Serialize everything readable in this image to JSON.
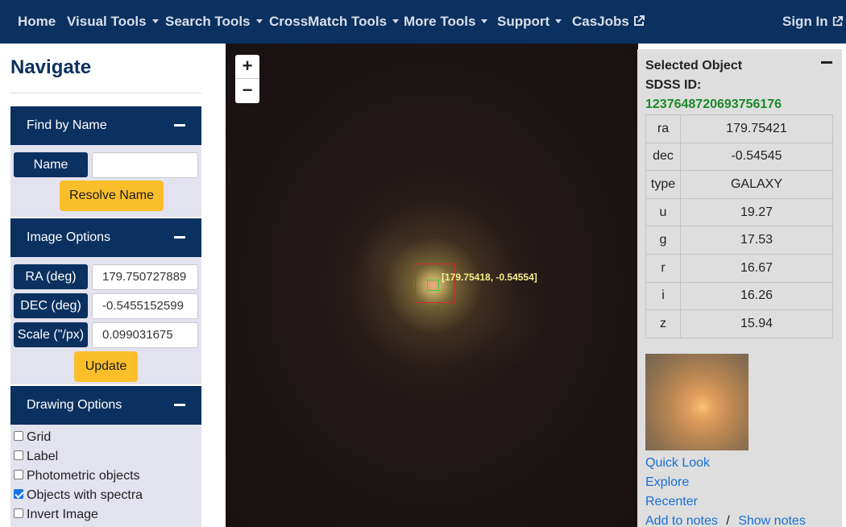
{
  "navbar": {
    "items": [
      {
        "label": "Home",
        "dropdown": false
      },
      {
        "label": "Visual Tools",
        "dropdown": true
      },
      {
        "label": "Search Tools",
        "dropdown": true
      },
      {
        "label": "CrossMatch Tools",
        "dropdown": true
      },
      {
        "label": "More Tools",
        "dropdown": true
      },
      {
        "label": "Support",
        "dropdown": true
      },
      {
        "label": "CasJobs",
        "external": true
      }
    ],
    "sign_in": "Sign In"
  },
  "sidebar": {
    "title": "Navigate",
    "find_by_name": {
      "header": "Find by Name",
      "name_label": "Name",
      "name_value": "",
      "resolve_button": "Resolve Name"
    },
    "image_options": {
      "header": "Image Options",
      "ra_label": "RA (deg)",
      "ra_value": "179.750727889",
      "dec_label": "DEC (deg)",
      "dec_value": "-0.5455152599",
      "scale_label": "Scale (\"/px)",
      "scale_value": "0.099031675",
      "update_button": "Update"
    },
    "drawing_options": {
      "header": "Drawing Options",
      "checkboxes": [
        {
          "label": "Grid",
          "checked": false
        },
        {
          "label": "Label",
          "checked": false
        },
        {
          "label": "Photometric objects",
          "checked": false
        },
        {
          "label": "Objects with spectra",
          "checked": true
        },
        {
          "label": "Invert Image",
          "checked": false
        }
      ]
    }
  },
  "map": {
    "zoom_in": "+",
    "zoom_out": "−",
    "marker_label": "[179.75418, -0.54554]"
  },
  "selected_object": {
    "title": "Selected Object",
    "sdss_label": "SDSS ID:",
    "sdss_id": "1237648720693756176",
    "rows": [
      {
        "key": "ra",
        "value": "179.75421"
      },
      {
        "key": "dec",
        "value": "-0.54545"
      },
      {
        "key": "type",
        "value": "GALAXY"
      },
      {
        "key": "u",
        "value": "19.27"
      },
      {
        "key": "g",
        "value": "17.53"
      },
      {
        "key": "r",
        "value": "16.67"
      },
      {
        "key": "i",
        "value": "16.26"
      },
      {
        "key": "z",
        "value": "15.94"
      }
    ],
    "links": {
      "quick_look": "Quick Look",
      "explore": "Explore",
      "recenter": "Recenter",
      "add_notes": "Add to notes",
      "separator": "/",
      "show_notes": "Show notes"
    }
  },
  "colors": {
    "navy": "#0b3160",
    "accent_yellow": "#fbbe2b",
    "id_green": "#1a8a2a",
    "link_blue": "#1a6fd6"
  }
}
